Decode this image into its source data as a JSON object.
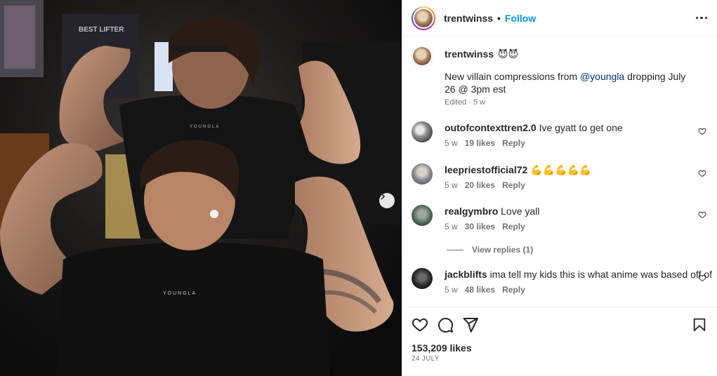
{
  "post": {
    "username": "trentwinss",
    "follow_label": "Follow",
    "separator": "•",
    "shirt_brand": "YOUNGLA",
    "gym_sign": "BEST LIFTER"
  },
  "caption": {
    "username": "trentwinss",
    "emoji": "😈😈",
    "text_before": "New villain compressions from ",
    "mention": "@youngla",
    "text_after": " dropping July 26 @ 3pm est",
    "meta": "Edited · 5 w"
  },
  "comments": [
    {
      "username": "outofcontexttren2.0",
      "text": "Ive gyatt to get one",
      "time": "5 w",
      "likes": "19 likes",
      "reply": "Reply"
    },
    {
      "username": "leepriestofficial72",
      "text": "💪💪💪💪💪",
      "time": "5 w",
      "likes": "20 likes",
      "reply": "Reply"
    },
    {
      "username": "realgymbro",
      "text": "Love yall",
      "time": "5 w",
      "likes": "30 likes",
      "reply": "Reply"
    },
    {
      "username": "jackblifts",
      "text": "ima tell my kids this is what anime was based off of",
      "time": "5 w",
      "likes": "48 likes",
      "reply": "Reply"
    }
  ],
  "view_replies": "View replies (1)",
  "likes_count": "153,209 likes",
  "date": "24 JULY",
  "icons": {
    "like": "heart-outline",
    "comment": "speech-bubble",
    "share": "paper-plane",
    "save": "bookmark",
    "more": "three-dots",
    "next": "chevron-right"
  },
  "colors": {
    "link": "#0095f6",
    "mention": "#00376b",
    "text": "#262626",
    "secondary": "#737373"
  }
}
